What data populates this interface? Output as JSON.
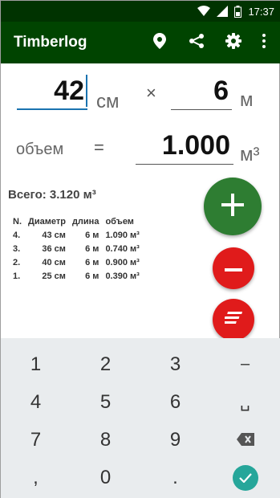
{
  "status_bar": {
    "time": "17:37"
  },
  "app_bar": {
    "title": "Timberlog"
  },
  "inputs": {
    "diameter": {
      "value": "42",
      "unit": "см"
    },
    "operator": "×",
    "length": {
      "value": "6",
      "unit": "м"
    },
    "volume_label": "объем",
    "equals": "=",
    "volume": {
      "value": "1.000",
      "unit": "м³"
    }
  },
  "total": "Всего: 3.120 м³",
  "table": {
    "headers": [
      "N.",
      "Диаметр",
      "длина",
      "объем"
    ],
    "rows": [
      [
        "4.",
        "43 см",
        "6 м",
        "1.090 м³"
      ],
      [
        "3.",
        "36 см",
        "6 м",
        "0.740 м³"
      ],
      [
        "2.",
        "40 см",
        "6 м",
        "0.900 м³"
      ],
      [
        "1.",
        "25 см",
        "6 м",
        "0.390 м³"
      ]
    ]
  },
  "keyboard": {
    "keys": [
      "1",
      "2",
      "3",
      "–",
      "4",
      "5",
      "6",
      "␣",
      "7",
      "8",
      "9",
      "",
      ",",
      "0",
      ".",
      ""
    ]
  },
  "colors": {
    "app_bar": "#004400",
    "status_bar": "#003300",
    "add_button": "#2e7d32",
    "remove_button": "#e01b1b",
    "accent": "#1a73b0",
    "confirm": "#26a69a"
  }
}
